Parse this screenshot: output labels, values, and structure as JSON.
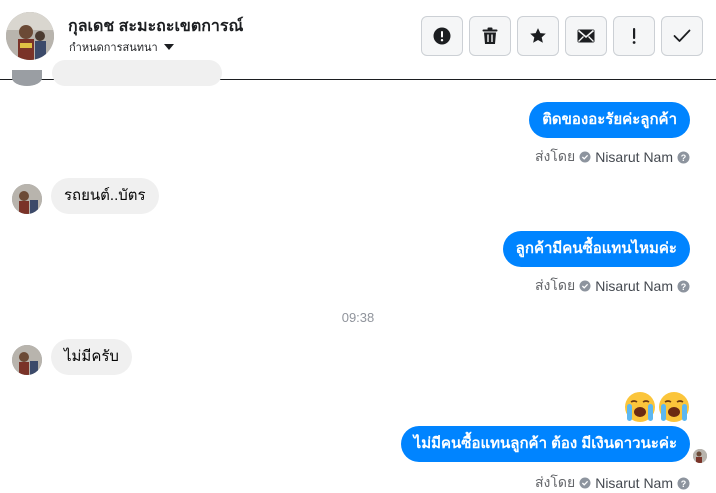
{
  "header": {
    "contact_name": "กุลเดช สะมะถะเขตการณ์",
    "conversation_settings": "กำหนดการสนทนา",
    "toolbar": [
      {
        "name": "mark-spam",
        "icon": "exclamation-circle-icon"
      },
      {
        "name": "delete",
        "icon": "trash-icon"
      },
      {
        "name": "star",
        "icon": "star-icon"
      },
      {
        "name": "mark-unread",
        "icon": "envelope-icon"
      },
      {
        "name": "important",
        "icon": "exclamation-icon"
      },
      {
        "name": "done",
        "icon": "checkmark-icon"
      }
    ]
  },
  "messages": [
    {
      "id": "m1",
      "direction": "out",
      "text": "ติดของอะรัยค่ะลูกค้า",
      "sent_by_label": "ส่งโดย",
      "sender": "Nisarut Nam"
    },
    {
      "id": "m2",
      "direction": "in",
      "text": "รถยนต์..บัตร"
    },
    {
      "id": "m3",
      "direction": "out",
      "text": "ลูกค้ามีคนซื้อแทนไหมค่ะ",
      "sent_by_label": "ส่งโดย",
      "sender": "Nisarut Nam"
    },
    {
      "id": "m4",
      "direction": "in",
      "text": "ไม่มีครับ"
    },
    {
      "id": "m5",
      "direction": "out",
      "emoji": [
        "loudly-crying-face",
        "loudly-crying-face"
      ]
    },
    {
      "id": "m6",
      "direction": "out",
      "text": "ไม่มีคนซื้อแทนลูกค้า ต้อง มีเงินดาวนะค่ะ",
      "sent_by_label": "ส่งโดย",
      "sender": "Nisarut Nam"
    }
  ],
  "timestamp": "09:38",
  "colors": {
    "outgoing_bubble": "#0084ff",
    "incoming_bubble": "#f0f0f0",
    "meta_text": "#65676b",
    "timestamp_text": "#90949c"
  }
}
